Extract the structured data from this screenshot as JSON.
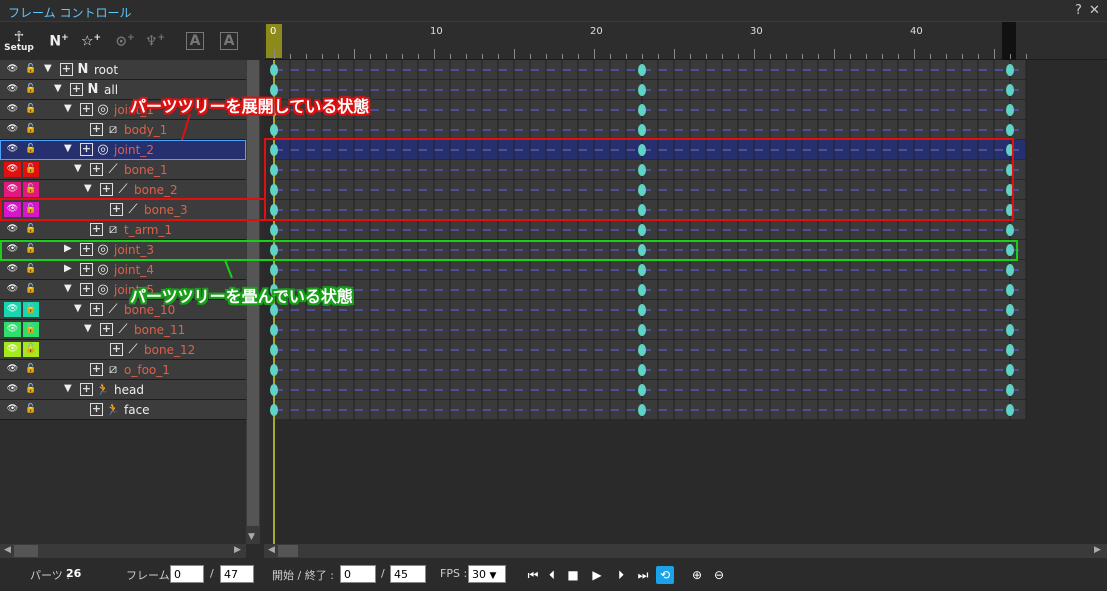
{
  "window": {
    "title": "フレーム コントロール",
    "help": "?",
    "close": "✕"
  },
  "toolbar": {
    "tools": [
      {
        "name": "setup",
        "icon": "person-setup-icon",
        "caption": "Setup",
        "enabled": true
      },
      {
        "name": "add-null",
        "icon": "null-add-icon",
        "enabled": true
      },
      {
        "name": "add-effect",
        "icon": "star-add-icon",
        "enabled": true
      },
      {
        "name": "add-joint",
        "icon": "joint-add-icon",
        "enabled": false
      },
      {
        "name": "add-bone",
        "icon": "bone-add-icon",
        "enabled": false
      },
      {
        "name": "text-a",
        "icon": "text-a-rotate-icon",
        "enabled": false
      },
      {
        "name": "text-a2",
        "icon": "text-a-add-icon",
        "enabled": false
      }
    ]
  },
  "tree": {
    "rows": [
      {
        "label": "root",
        "depth": 0,
        "arrow": "▼",
        "icon": "null-icon",
        "glyph": "N",
        "color": "white",
        "visColor": "",
        "lockColor": ""
      },
      {
        "label": "all",
        "depth": 1,
        "arrow": "▼",
        "icon": "null-icon",
        "glyph": "N",
        "color": "white",
        "visColor": "",
        "lockColor": ""
      },
      {
        "label": "joint_1",
        "depth": 2,
        "arrow": "▼",
        "icon": "joint-icon",
        "glyph": "◎",
        "color": "red",
        "visColor": "",
        "lockColor": ""
      },
      {
        "label": "body_1",
        "depth": 3,
        "arrow": "",
        "icon": "mesh-icon",
        "glyph": "⧄",
        "color": "red",
        "visColor": "",
        "lockColor": ""
      },
      {
        "label": "joint_2",
        "depth": 2,
        "arrow": "▼",
        "icon": "joint-icon",
        "glyph": "◎",
        "color": "red",
        "visColor": "",
        "lockColor": "",
        "selected": true
      },
      {
        "label": "bone_1",
        "depth": 3,
        "arrow": "▼",
        "icon": "bone-icon",
        "glyph": "⟋",
        "color": "red",
        "visColor": "#e01010",
        "lockColor": "#e01010"
      },
      {
        "label": "bone_2",
        "depth": 4,
        "arrow": "▼",
        "icon": "bone-icon",
        "glyph": "⟋",
        "color": "red",
        "visColor": "#e0187f",
        "lockColor": "#e0187f"
      },
      {
        "label": "bone_3",
        "depth": 5,
        "arrow": "",
        "icon": "bone-icon",
        "glyph": "⟋",
        "color": "red",
        "visColor": "#d616c8",
        "lockColor": "#d616c8"
      },
      {
        "label": "t_arm_1",
        "depth": 3,
        "arrow": "",
        "icon": "mesh-icon",
        "glyph": "⧄",
        "color": "red",
        "visColor": "",
        "lockColor": ""
      },
      {
        "label": "joint_3",
        "depth": 2,
        "arrow": "▶",
        "icon": "joint-icon",
        "glyph": "◎",
        "color": "red",
        "visColor": "",
        "lockColor": ""
      },
      {
        "label": "joint_4",
        "depth": 2,
        "arrow": "▶",
        "icon": "joint-icon",
        "glyph": "◎",
        "color": "red",
        "visColor": "",
        "lockColor": ""
      },
      {
        "label": "joint_5",
        "depth": 2,
        "arrow": "▼",
        "icon": "joint-icon",
        "glyph": "◎",
        "color": "red",
        "visColor": "",
        "lockColor": ""
      },
      {
        "label": "bone_10",
        "depth": 3,
        "arrow": "▼",
        "icon": "bone-icon",
        "glyph": "⟋",
        "color": "red",
        "visColor": "#18d6b0",
        "lockColor": "#18d6b0"
      },
      {
        "label": "bone_11",
        "depth": 4,
        "arrow": "▼",
        "icon": "bone-icon",
        "glyph": "⟋",
        "color": "red",
        "visColor": "#2ee06a",
        "lockColor": "#2ee06a"
      },
      {
        "label": "bone_12",
        "depth": 5,
        "arrow": "",
        "icon": "bone-icon",
        "glyph": "⟋",
        "color": "red",
        "visColor": "#a6e81e",
        "lockColor": "#a6e81e"
      },
      {
        "label": "o_foo_1",
        "depth": 3,
        "arrow": "",
        "icon": "mesh-icon",
        "glyph": "⧄",
        "color": "red",
        "visColor": "",
        "lockColor": ""
      },
      {
        "label": "head",
        "depth": 2,
        "arrow": "▼",
        "icon": "figure-icon",
        "glyph": "🏃",
        "color": "white",
        "visColor": "",
        "lockColor": ""
      },
      {
        "label": "face",
        "depth": 3,
        "arrow": "",
        "icon": "figure-icon",
        "glyph": "🏃",
        "color": "white",
        "visColor": "",
        "lockColor": ""
      }
    ]
  },
  "ruler": {
    "labels": [
      "0",
      "10",
      "20",
      "30",
      "40"
    ],
    "current_frame": "0"
  },
  "timeline": {
    "total_frames": 47,
    "keyframes": [
      0,
      23,
      46
    ]
  },
  "annotations": {
    "expanded": "パーツツリーを展開している状態",
    "collapsed": "パーツツリーを畳んでいる状態",
    "red_color": "#e01010",
    "green_color": "#19d019"
  },
  "status": {
    "parts_label": "パーツ :",
    "parts_value": "26",
    "frame_label": "フレーム :",
    "frame_value": "0",
    "frame_sep": "/",
    "frame_total": "47",
    "range_label": "開始 / 終了 :",
    "range_start": "0",
    "range_sep": "/",
    "range_end": "45",
    "fps_label": "FPS :",
    "fps_value": "30",
    "fps_arrow": "▼"
  },
  "playback": [
    {
      "name": "first-frame",
      "icon": "skip-start-icon",
      "glyph": "⏮"
    },
    {
      "name": "prev-frame",
      "icon": "step-back-icon",
      "glyph": "⏴"
    },
    {
      "name": "stop",
      "icon": "stop-icon",
      "glyph": "■"
    },
    {
      "name": "play",
      "icon": "play-icon",
      "glyph": "▶"
    },
    {
      "name": "next-frame",
      "icon": "step-forward-icon",
      "glyph": "⏵"
    },
    {
      "name": "last-frame",
      "icon": "skip-end-icon",
      "glyph": "⏭"
    },
    {
      "name": "loop",
      "icon": "loop-icon",
      "glyph": "⟲",
      "active": true
    },
    {
      "name": "zoom-in",
      "icon": "zoom-in-icon",
      "glyph": "⊕"
    },
    {
      "name": "zoom-out",
      "icon": "zoom-out-icon",
      "glyph": "⊖"
    }
  ]
}
